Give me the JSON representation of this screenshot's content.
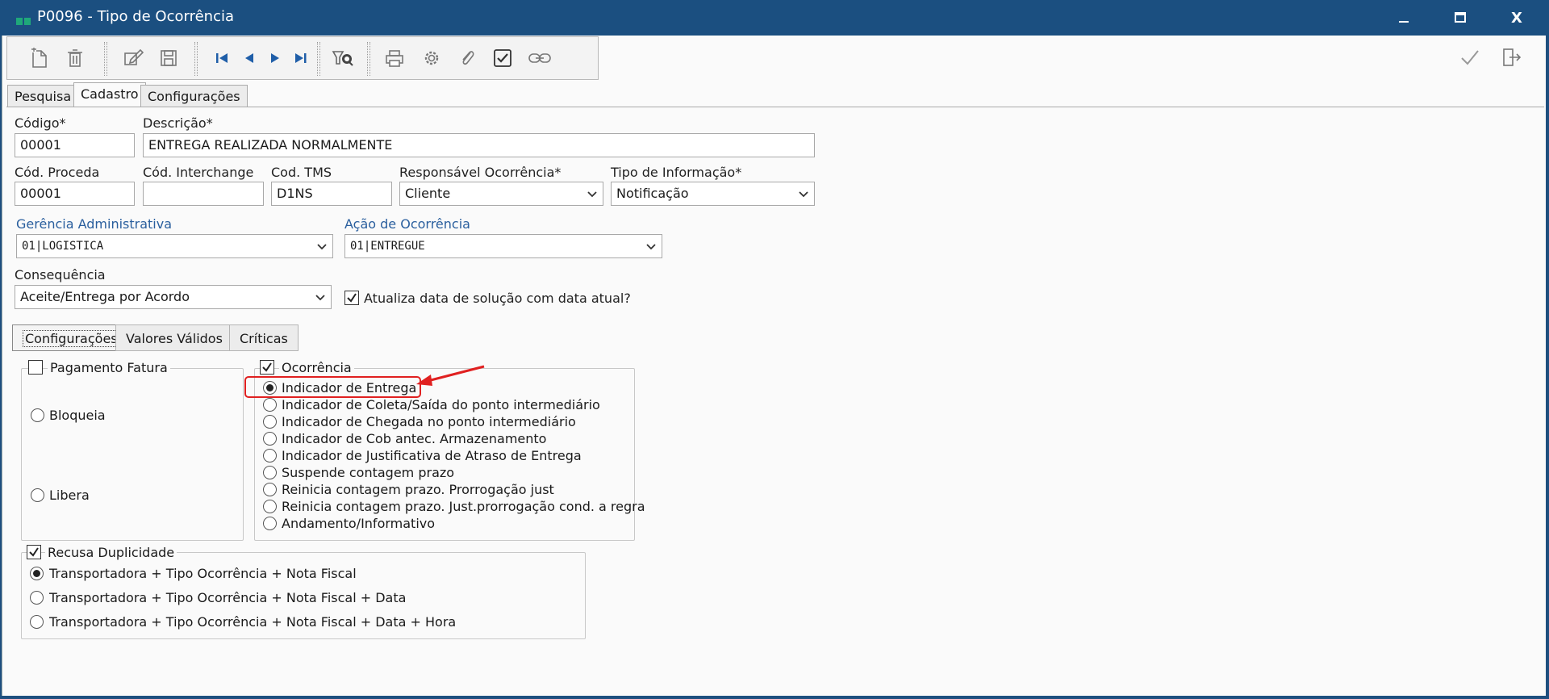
{
  "window": {
    "title": "P0096 - Tipo de Ocorrência",
    "minimize_label": "",
    "maximize_label": "",
    "close_label": "X"
  },
  "tabs": [
    {
      "label": "Pesquisa"
    },
    {
      "label": "Cadastro"
    },
    {
      "label": "Configurações"
    }
  ],
  "form": {
    "codigo": {
      "label": "Código*",
      "value": "00001"
    },
    "descricao": {
      "label": "Descrição*",
      "value": "ENTREGA REALIZADA NORMALMENTE"
    },
    "cod_proceda": {
      "label": "Cód. Proceda",
      "value": "00001"
    },
    "cod_interchange": {
      "label": "Cód. Interchange",
      "value": ""
    },
    "cod_tms": {
      "label": "Cod. TMS",
      "value": "D1NS"
    },
    "responsavel": {
      "label": "Responsável Ocorrência*",
      "value": "Cliente"
    },
    "tipo_informacao": {
      "label": "Tipo de Informação*",
      "value": "Notificação"
    },
    "gerencia": {
      "label": "Gerência Administrativa",
      "value": "01|LOGISTICA"
    },
    "acao": {
      "label": "Ação de Ocorrência",
      "value": "01|ENTREGUE"
    },
    "consequencia": {
      "label": "Consequência",
      "value": "Aceite/Entrega por Acordo"
    },
    "atualiza_data": {
      "label": "Atualiza data de solução com data atual?",
      "checked": true
    }
  },
  "subtabs": [
    {
      "label": "Configurações"
    },
    {
      "label": "Valores Válidos"
    },
    {
      "label": "Críticas"
    }
  ],
  "pagamento": {
    "label": "Pagamento Fatura",
    "checked": false,
    "options": [
      "Bloqueia",
      "Libera"
    ]
  },
  "ocorrencia": {
    "label": "Ocorrência",
    "checked": true,
    "selected": 0,
    "options": [
      "Indicador de Entrega",
      "Indicador de Coleta/Saída do ponto intermediário",
      "Indicador de Chegada no ponto intermediário",
      "Indicador de Cob antec. Armazenamento",
      "Indicador de Justificativa de Atraso de Entrega",
      "Suspende contagem prazo",
      "Reinicia contagem prazo. Prorrogação just",
      "Reinicia contagem prazo. Just.prorrogação cond. a regra",
      "Andamento/Informativo"
    ]
  },
  "recusa": {
    "label": "Recusa Duplicidade",
    "checked": true,
    "selected": 0,
    "options": [
      "Transportadora + Tipo Ocorrência + Nota Fiscal",
      "Transportadora + Tipo Ocorrência + Nota Fiscal + Data",
      "Transportadora + Tipo Ocorrência + Nota Fiscal + Data + Hora"
    ]
  },
  "colors": {
    "titlebar": "#1b4f80",
    "highlight": "#e02020",
    "label_blue": "#2a5f9e",
    "icon_blue": "#1f5ea8"
  }
}
